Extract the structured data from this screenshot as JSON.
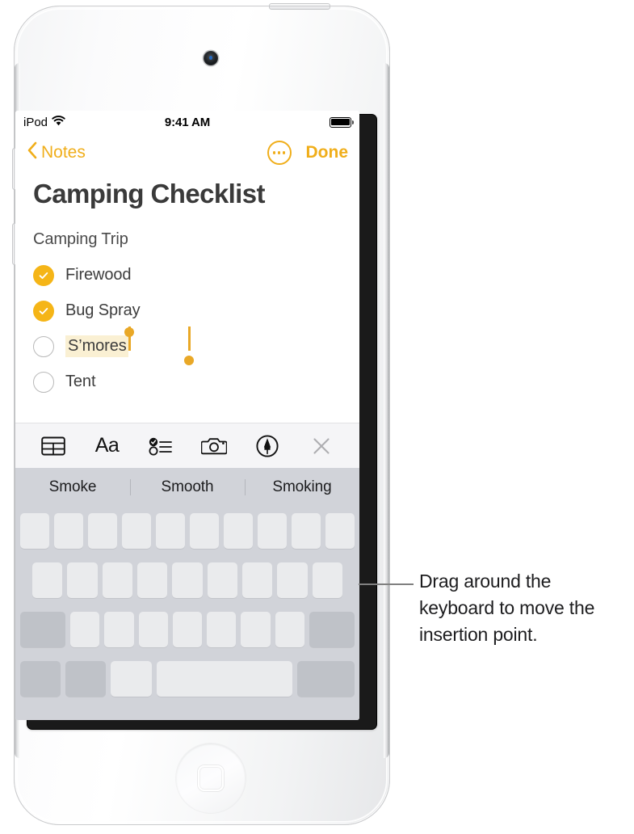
{
  "device": {
    "name": "iPod touch",
    "camera": "front-camera",
    "home_button": "home-button"
  },
  "status_bar": {
    "carrier": "iPod",
    "wifi_icon": "wifi-icon",
    "time": "9:41 AM",
    "battery_icon": "battery-full-icon"
  },
  "nav_bar": {
    "back_label": "Notes",
    "back_chevron": "chevron-left-icon",
    "more_icon": "ellipsis-circle-icon",
    "done_label": "Done"
  },
  "note": {
    "title": "Camping Checklist",
    "subtitle": "Camping Trip",
    "items": [
      {
        "label": "Firewood",
        "checked": true,
        "selected": false
      },
      {
        "label": "Bug Spray",
        "checked": true,
        "selected": false
      },
      {
        "label": "S’mores",
        "checked": false,
        "selected": true
      },
      {
        "label": "Tent",
        "checked": false,
        "selected": false
      }
    ]
  },
  "format_toolbar": {
    "items": [
      {
        "name": "table-icon",
        "label": "Table"
      },
      {
        "name": "text-format-icon",
        "label": "Aa"
      },
      {
        "name": "checklist-icon",
        "label": "Checklist"
      },
      {
        "name": "camera-icon",
        "label": "Camera"
      },
      {
        "name": "markup-pen-icon",
        "label": "Markup"
      },
      {
        "name": "close-icon",
        "label": "Close"
      }
    ]
  },
  "predictive_bar": {
    "suggestions": [
      "Smoke",
      "Smooth",
      "Smoking"
    ]
  },
  "keyboard": {
    "mode": "trackpad",
    "rows": [
      {
        "keys": 10,
        "dark_first": false,
        "dark_last": false
      },
      {
        "keys": 9,
        "dark_first": false,
        "dark_last": false
      },
      {
        "keys": 9,
        "dark_first": true,
        "dark_last": true
      },
      {
        "keys": 5,
        "dark_first": true,
        "dark_last": true
      }
    ]
  },
  "callout": {
    "text": "Drag around the keyboard to move the insertion point."
  },
  "colors": {
    "accent": "#F0AE1A",
    "checkbox_filled": "#F5B517",
    "selection_highlight": "#FAF0D3",
    "selection_handle": "#E9A827",
    "toolbar_bg": "#F5F5F7",
    "keyboard_bg": "#D1D3D9",
    "key_bg": "#EAEBED",
    "key_dark_bg": "#BFC2C8"
  }
}
